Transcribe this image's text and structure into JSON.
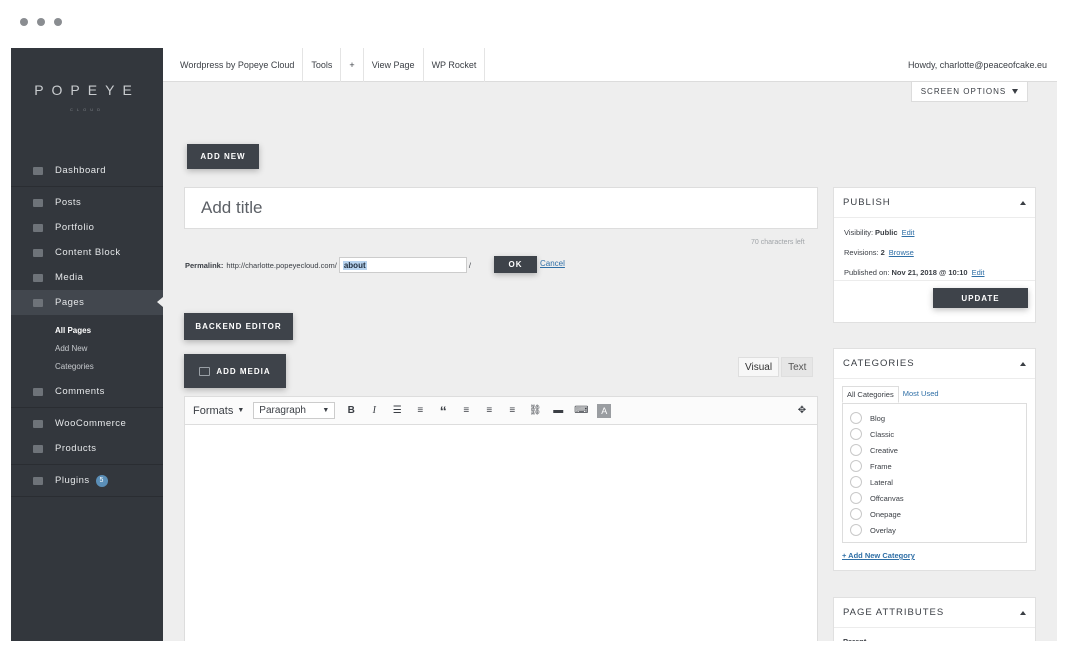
{
  "topbar": {
    "items": [
      "Wordpress by Popeye Cloud",
      "Tools",
      "+",
      "View Page",
      "WP Rocket"
    ],
    "greeting": "Howdy, charlotte@peaceofcake.eu"
  },
  "brand": {
    "logo": "POPEYE",
    "logo_sub": "CLOUD"
  },
  "sidebar": {
    "items": [
      {
        "label": "Dashboard",
        "icon": "dashboard-icon"
      },
      {
        "label": "Posts",
        "icon": "pin-icon"
      },
      {
        "label": "Portfolio",
        "icon": "grid-icon"
      },
      {
        "label": "Content Block",
        "icon": "block-icon"
      },
      {
        "label": "Media",
        "icon": "media-icon"
      },
      {
        "label": "Pages",
        "icon": "page-icon"
      },
      {
        "label": "Comments",
        "icon": "comment-icon"
      },
      {
        "label": "WooCommerce",
        "icon": "woo-icon"
      },
      {
        "label": "Products",
        "icon": "box-icon"
      },
      {
        "label": "Plugins",
        "icon": "plug-icon"
      }
    ],
    "subitems": [
      "All Pages",
      "Add New",
      "Categories"
    ],
    "plugins_badge": "5"
  },
  "screen_options": "SCREEN OPTIONS",
  "add_new": "ADD NEW",
  "title_placeholder": "Add title",
  "chars_left": "70 characters left",
  "permalink": {
    "label": "Permalink:",
    "base": "http://charlotte.popeyecloud.com/",
    "slug": "about",
    "slash": "/",
    "ok": "OK",
    "cancel": "Cancel"
  },
  "backend_editor": "BACKEND EDITOR",
  "add_media": "ADD MEDIA",
  "editor_tabs": [
    "Visual",
    "Text"
  ],
  "toolbar": {
    "formats": "Formats",
    "paragraph": "Paragraph"
  },
  "publish": {
    "title": "PUBLISH",
    "visibility_label": "Visibility:",
    "visibility_value": "Public",
    "revisions_label": "Revisions:",
    "revisions_value": "2",
    "published_label": "Published on:",
    "published_value": "Nov 21, 2018 @ 10:10",
    "edit": "Edit",
    "browse": "Browse",
    "update": "UPDATE"
  },
  "categories": {
    "title": "CATEGORIES",
    "tabs": [
      "All Categories",
      "Most Used"
    ],
    "items": [
      "Blog",
      "Classic",
      "Creative",
      "Frame",
      "Lateral",
      "Offcanvas",
      "Onepage",
      "Overlay"
    ],
    "add": "+ Add New Category"
  },
  "page_attributes": {
    "title": "PAGE ATTRIBUTES",
    "parent": "Parent"
  }
}
